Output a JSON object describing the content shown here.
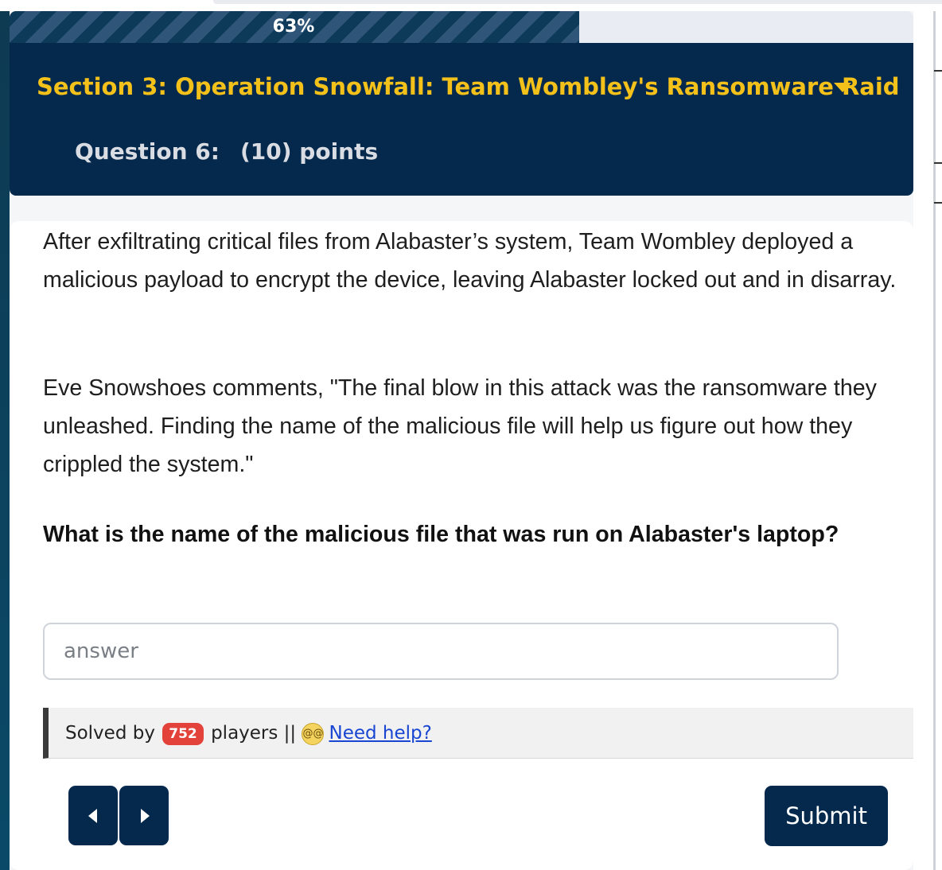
{
  "progress": {
    "percent_label": "63%",
    "value": 0.63
  },
  "section": {
    "title": "Section 3: Operation Snowfall: Team Wombley's Ransomware Raid"
  },
  "question": {
    "label": "Question 6:",
    "points": "(10) points",
    "paragraph1": "After exfiltrating critical files from Alabaster’s system, Team Wombley deployed a malicious payload to encrypt the device, leaving Alabaster locked out and in disarray.",
    "paragraph2": "Eve Snowshoes comments, \"The final blow in this attack was the ransomware they unleashed. Finding the name of the malicious file will help us figure out how they crippled the system.\"",
    "prompt": "What is the name of the malicious file that was run on Alabaster's laptop?"
  },
  "answer": {
    "placeholder": "answer",
    "value": ""
  },
  "solved": {
    "prefix": "Solved by",
    "count": "752",
    "suffix": "players ||",
    "help_label": "Need help?",
    "help_icon": "dizzy-face-emoji"
  },
  "nav": {
    "prev_icon": "caret-left-icon",
    "next_icon": "caret-right-icon"
  },
  "actions": {
    "submit_label": "Submit"
  },
  "colors": {
    "navy": "#04294d",
    "gold": "#f3c11a",
    "badge_red": "#e2423a",
    "link_blue": "#1846d2"
  }
}
